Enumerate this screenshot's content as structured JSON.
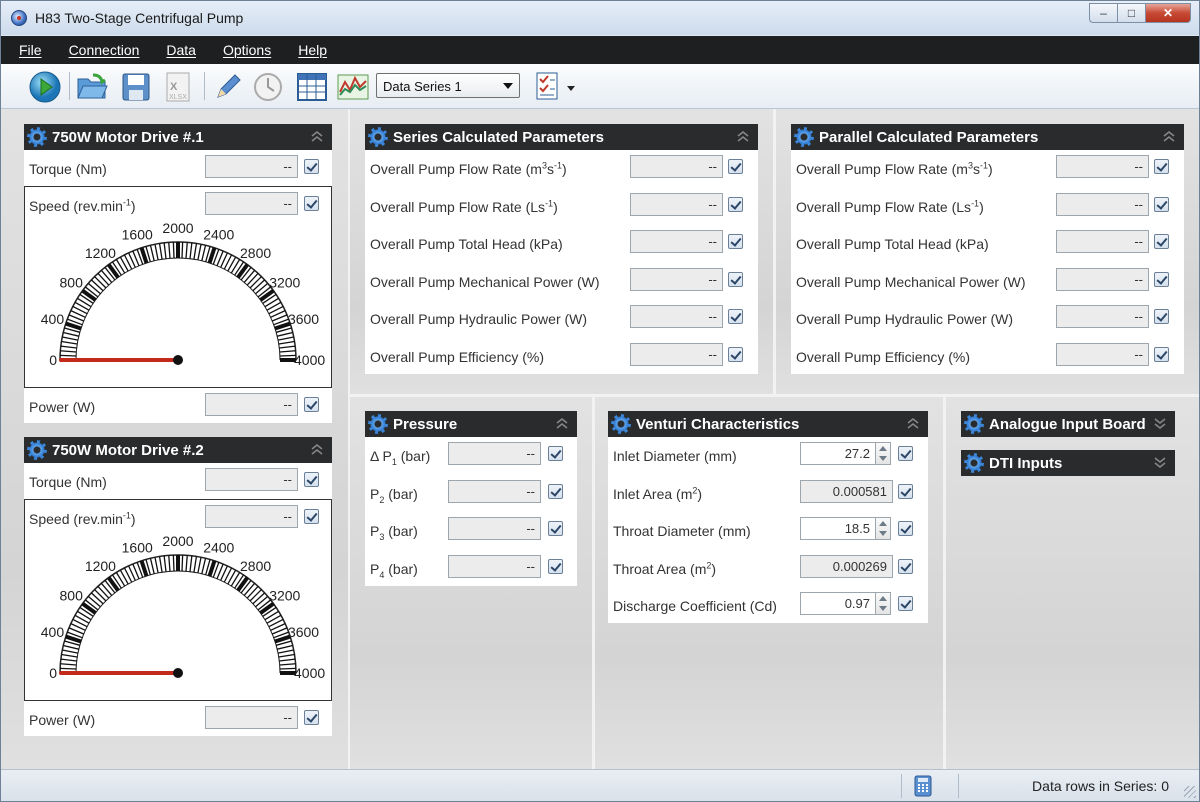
{
  "window": {
    "title": "H83 Two-Stage Centrifugal Pump",
    "minimize": "–",
    "maximize": "□",
    "close": "✕"
  },
  "menu": [
    "File",
    "Connection",
    "Data",
    "Options",
    "Help"
  ],
  "toolbar": {
    "series_select": "Data Series 1"
  },
  "motor1": {
    "title": "750W Motor Drive #.1",
    "torque_label": "Torque  (Nm)",
    "torque_value": "--",
    "speed_label_pre": "Speed  (rev.min",
    "speed_label_exp": "-1",
    "speed_label_post": ")",
    "speed_value": "--",
    "power_label": "Power  (W)",
    "power_value": "--"
  },
  "motor2": {
    "title": "750W Motor Drive #.2",
    "torque_label": "Torque  (Nm)",
    "torque_value": "--",
    "speed_label_pre": "Speed  (rev.min",
    "speed_label_exp": "-1",
    "speed_label_post": ")",
    "speed_value": "--",
    "power_label": "Power  (W)",
    "power_value": "--"
  },
  "gauge": {
    "labels": [
      "0",
      "400",
      "800",
      "1200",
      "1600",
      "2000",
      "2400",
      "2800",
      "3200",
      "3600",
      "4000"
    ],
    "min": 0,
    "max": 4000,
    "value": 0
  },
  "series": {
    "title": "Series Calculated Parameters",
    "rows": [
      {
        "label": "Overall Pump Flow Rate  (m",
        "sup1": "3",
        "mid": "s",
        "sup2": "-1",
        "end": ")",
        "value": "--"
      },
      {
        "label": "Overall Pump Flow Rate  (Ls",
        "sup1": "-1",
        "mid": "",
        "sup2": "",
        "end": ")",
        "value": "--"
      },
      {
        "label": "Overall Pump Total Head  (kPa)",
        "sup1": "",
        "mid": "",
        "sup2": "",
        "end": "",
        "value": "--"
      },
      {
        "label": "Overall Pump Mechanical Power  (W)",
        "sup1": "",
        "mid": "",
        "sup2": "",
        "end": "",
        "value": "--"
      },
      {
        "label": "Overall Pump Hydraulic Power  (W)",
        "sup1": "",
        "mid": "",
        "sup2": "",
        "end": "",
        "value": "--"
      },
      {
        "label": "Overall Pump Efficiency  (%)",
        "sup1": "",
        "mid": "",
        "sup2": "",
        "end": "",
        "value": "--"
      }
    ]
  },
  "parallel": {
    "title": "Parallel Calculated Parameters",
    "rows": [
      {
        "label": "Overall Pump Flow Rate  (m",
        "sup1": "3",
        "mid": "s",
        "sup2": "-1",
        "end": ")",
        "value": "--"
      },
      {
        "label": "Overall Pump Flow Rate  (Ls",
        "sup1": "-1",
        "mid": "",
        "sup2": "",
        "end": ")",
        "value": "--"
      },
      {
        "label": "Overall Pump Total Head  (kPa)",
        "sup1": "",
        "mid": "",
        "sup2": "",
        "end": "",
        "value": "--"
      },
      {
        "label": "Overall Pump Mechanical Power  (W)",
        "sup1": "",
        "mid": "",
        "sup2": "",
        "end": "",
        "value": "--"
      },
      {
        "label": "Overall Pump Hydraulic Power  (W)",
        "sup1": "",
        "mid": "",
        "sup2": "",
        "end": "",
        "value": "--"
      },
      {
        "label": "Overall Pump Efficiency  (%)",
        "sup1": "",
        "mid": "",
        "sup2": "",
        "end": "",
        "value": "--"
      }
    ]
  },
  "pressure": {
    "title": "Pressure",
    "rows": [
      {
        "pre": "Δ P",
        "sub": "1",
        "post": "  (bar)",
        "value": "--"
      },
      {
        "pre": "P",
        "sub": "2",
        "post": "  (bar)",
        "value": "--"
      },
      {
        "pre": "P",
        "sub": "3",
        "post": "  (bar)",
        "value": "--"
      },
      {
        "pre": "P",
        "sub": "4",
        "post": "  (bar)",
        "value": "--"
      }
    ]
  },
  "venturi": {
    "title": "Venturi Characteristics",
    "rows": [
      {
        "label": "Inlet Diameter  (mm)",
        "sup": "",
        "end": "",
        "value": "27.2"
      },
      {
        "label": "Inlet Area  (m",
        "sup": "2",
        "end": ")",
        "value": "0.000581"
      },
      {
        "label": "Throat Diameter  (mm)",
        "sup": "",
        "end": "",
        "value": "18.5"
      },
      {
        "label": "Throat Area  (m",
        "sup": "2",
        "end": ")",
        "value": "0.000269"
      },
      {
        "label": "Discharge Coefficient  (Cd)",
        "sup": "",
        "end": "",
        "value": "0.97"
      }
    ]
  },
  "analogue": {
    "title": "Analogue Input Board"
  },
  "dti": {
    "title": "DTI Inputs"
  },
  "statusbar": {
    "text": "Data rows in Series: 0"
  }
}
